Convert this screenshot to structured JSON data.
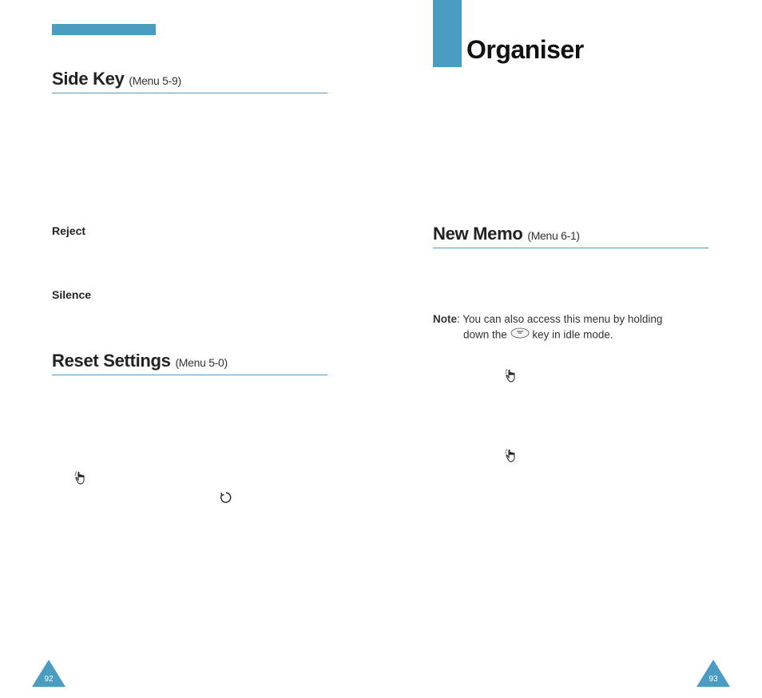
{
  "left": {
    "section1": {
      "title": "Side Key",
      "menu_ref": "(Menu 5-9)"
    },
    "option1": "Reject",
    "option2": "Silence",
    "section2": {
      "title": "Reset Settings",
      "menu_ref": "(Menu 5-0)"
    },
    "page_number": "92"
  },
  "right": {
    "chapter_title": "Organiser",
    "section1": {
      "title": "New Memo",
      "menu_ref": "(Menu 6-1)"
    },
    "note_label": "Note",
    "note_text_a": ": You can also access this menu by holding",
    "note_text_b": "down the",
    "note_text_c": "key in idle mode.",
    "page_number": "93"
  }
}
